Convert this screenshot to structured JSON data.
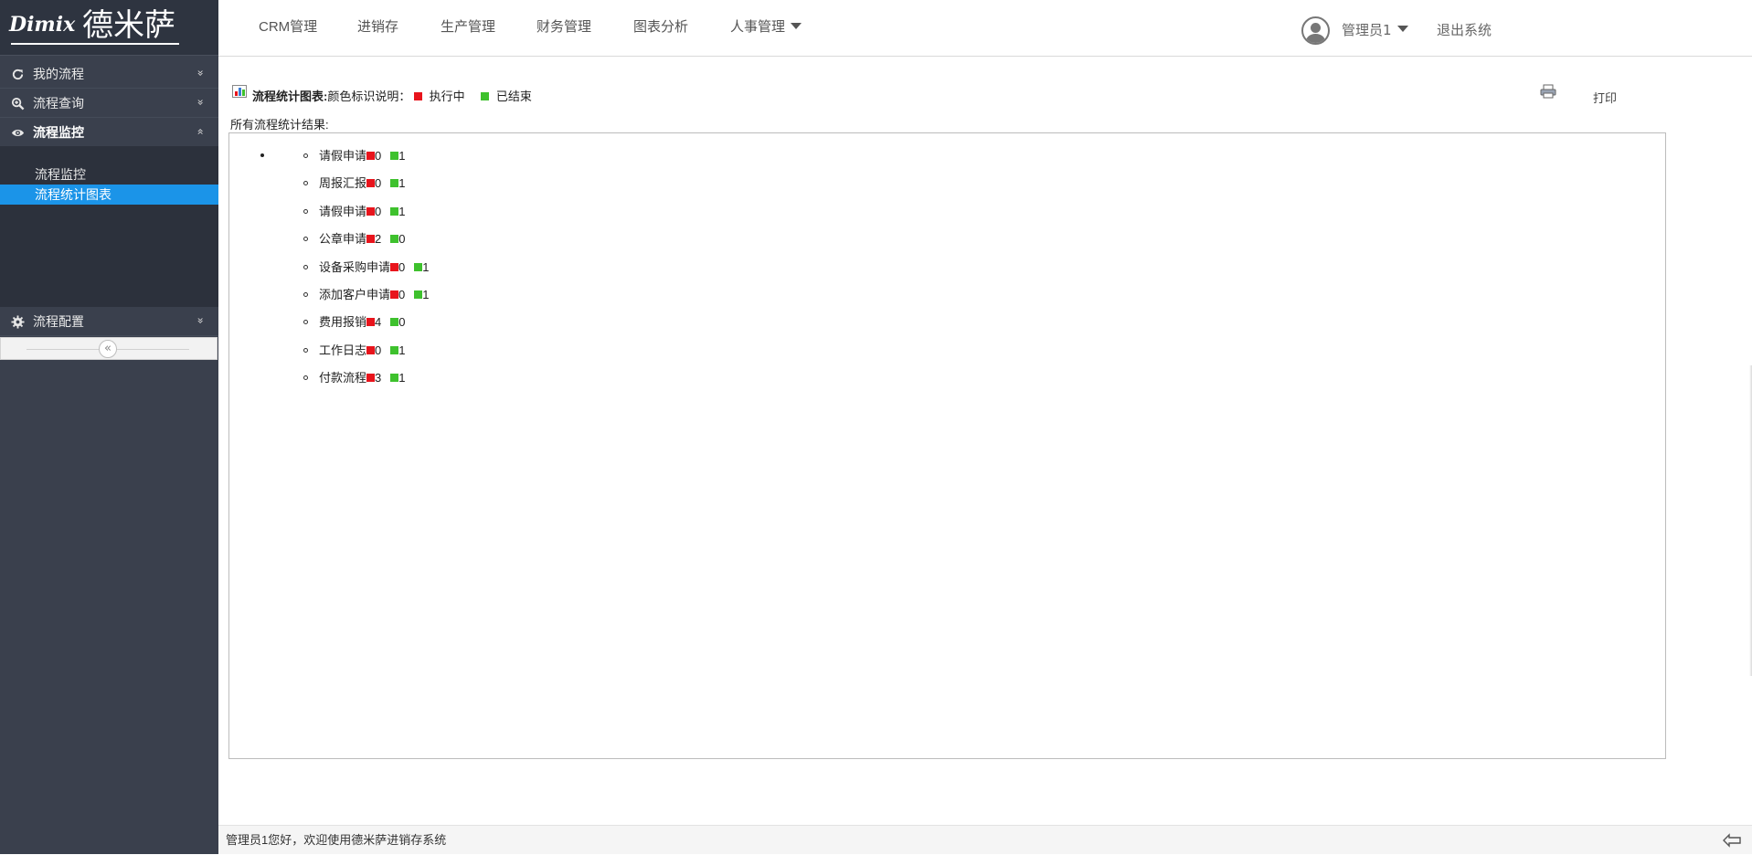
{
  "logo": {
    "script": "Dimix",
    "chinese": "德米萨"
  },
  "sidebar": {
    "groups": [
      {
        "label": "我的流程",
        "icon": "refresh-icon",
        "chevron": "»"
      },
      {
        "label": "流程查询",
        "icon": "zoom-icon",
        "chevron": "»"
      },
      {
        "label": "流程监控",
        "icon": "eye-icon",
        "chevron": "«"
      },
      {
        "label": "流程配置",
        "icon": "gear-icon",
        "chevron": "»"
      }
    ],
    "submenu": [
      {
        "label": "流程监控",
        "selected": false
      },
      {
        "label": "流程统计图表",
        "selected": true
      }
    ],
    "collapse_glyph": "«"
  },
  "nav": {
    "items": [
      "CRM管理",
      "进销存",
      "生产管理",
      "财务管理",
      "图表分析",
      "人事管理"
    ],
    "user": "管理员1",
    "logout": "退出系统"
  },
  "main": {
    "title_bold": "流程统计图表:",
    "title_legend_label": "颜色标识说明：",
    "legend": [
      {
        "label": "执行中",
        "color": "#e8141c"
      },
      {
        "label": "已结束",
        "color": "#3ec12d"
      }
    ],
    "print_label": "打印",
    "results_label": "所有流程统计结果:",
    "stats": [
      {
        "name": "请假申请",
        "running": "0",
        "finished": "1"
      },
      {
        "name": "周报汇报",
        "running": "0",
        "finished": "1"
      },
      {
        "name": "请假申请",
        "running": "0",
        "finished": "1"
      },
      {
        "name": "公章申请",
        "running": "2",
        "finished": "0"
      },
      {
        "name": "设备采购申请",
        "running": "0",
        "finished": "1"
      },
      {
        "name": "添加客户申请",
        "running": "0",
        "finished": "1"
      },
      {
        "name": "费用报销",
        "running": "4",
        "finished": "0"
      },
      {
        "name": "工作日志",
        "running": "0",
        "finished": "1"
      },
      {
        "name": "付款流程",
        "running": "3",
        "finished": "1"
      }
    ]
  },
  "footer": {
    "text": "管理员1您好，欢迎使用德米萨进销存系统"
  }
}
